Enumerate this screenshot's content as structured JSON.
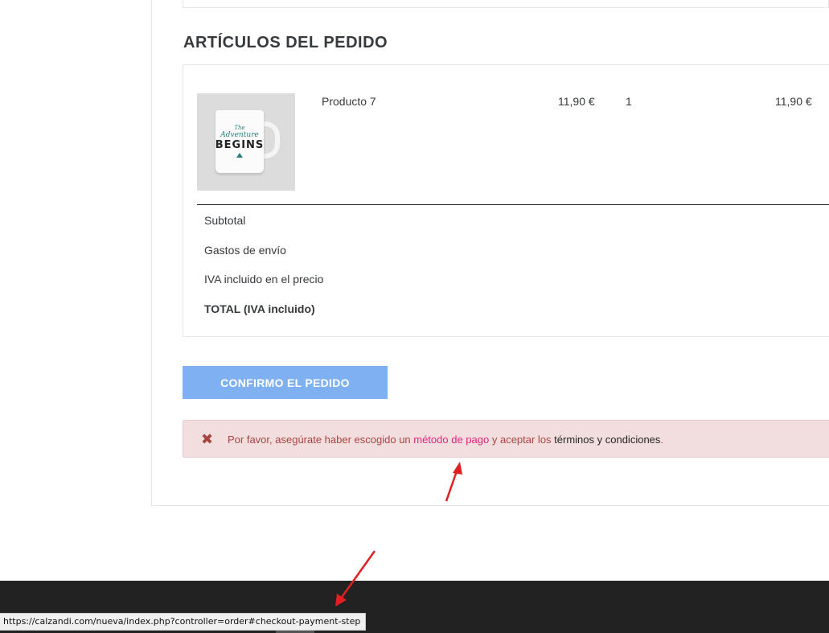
{
  "section": {
    "title": "ARTÍCULOS DEL PEDIDO"
  },
  "item": {
    "name": "Producto 7",
    "unit_price": "11,90 €",
    "quantity": "1",
    "total": "11,90 €",
    "image_text": {
      "line1": "The",
      "line2": "Adventure",
      "line3": "BEGINS"
    }
  },
  "totals": {
    "subtotal_label": "Subtotal",
    "shipping_label": "Gastos de envío",
    "tax_label": "IVA incluido en el precio",
    "total_label": "TOTAL (IVA incluido)"
  },
  "actions": {
    "confirm_label": "CONFIRMO EL PEDIDO"
  },
  "alert": {
    "icon": "close-x-icon",
    "text_before": "Por favor, asegúrate haber escogido un ",
    "payment_link": "método de pago",
    "text_middle": " y aceptar los ",
    "terms_link": "términos y condiciones",
    "text_after": "."
  },
  "status_bar": {
    "url": "https://calzandi.com/nueva/index.php?controller=order#checkout-payment-step"
  },
  "colors": {
    "button": "#7fb1f2",
    "alert_bg": "#f2dede",
    "alert_text": "#a94442",
    "link_accent": "#e2237a",
    "annotation_arrow": "#e02020",
    "footer": "#222222"
  }
}
